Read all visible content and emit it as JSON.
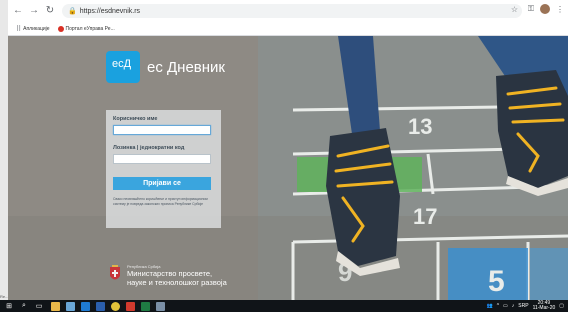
{
  "browser": {
    "url": "https://esdnevnik.rs",
    "bookmarks": [
      {
        "label": "Апликације",
        "icon": "apps-grid-icon"
      },
      {
        "label": "Портал eУправа Ре...",
        "icon": "portal-favicon"
      }
    ]
  },
  "brand": {
    "logo_text": "есД",
    "name": "ес Дневник",
    "color": "#1aa1df"
  },
  "login": {
    "username_label": "Корисничко име",
    "username_value": "",
    "password_label": "Лозинка | једнократни код",
    "password_value": "",
    "submit_label": "Пријави се",
    "notice": "Свако неовлашћено коришћење и приступ информационом систему је повреда законских прописа Републике Србије"
  },
  "ministry": {
    "country": "Република Србија",
    "line1": "Министарство просвете,",
    "line2": "науке и технолошког развоја"
  },
  "taskbar": {
    "apps": [
      "start-icon",
      "search-icon",
      "task-view-icon",
      "file-explorer-icon",
      "store-icon",
      "edge-icon",
      "word-icon",
      "chrome-icon",
      "acrobat-icon",
      "excel-icon",
      "app-icon"
    ],
    "clock_time": "20:49",
    "clock_date": "11-Mar-20",
    "language": "SRP"
  },
  "edge_label": "Re..."
}
